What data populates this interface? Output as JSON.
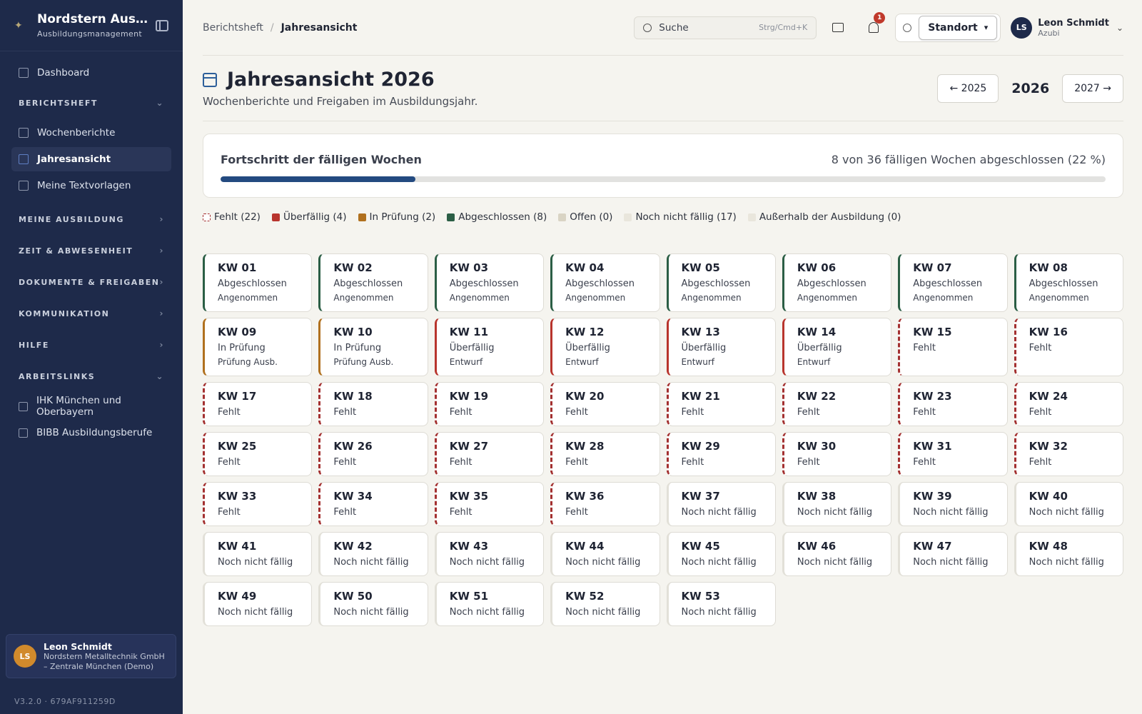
{
  "sidebar": {
    "brand_title": "Nordstern Ausbil…",
    "brand_sub": "Ausbildungsmanagement",
    "dashboard": "Dashboard",
    "sec_berichtsheft": "BERICHTSHEFT",
    "wochenberichte": "Wochenberichte",
    "jahresansicht": "Jahresansicht",
    "textvorlagen": "Meine Textvorlagen",
    "sec_ausbildung": "MEINE AUSBILDUNG",
    "sec_zeit": "ZEIT & ABWESENHEIT",
    "sec_dokumente": "DOKUMENTE & FREIGABEN",
    "sec_kommunikation": "KOMMUNIKATION",
    "sec_hilfe": "HILFE",
    "sec_arbeitslinks": "ARBEITSLINKS",
    "link_ihk": "IHK München und Oberbayern",
    "link_bibb": "BIBB Ausbildungsberufe",
    "user_initials": "LS",
    "user_name": "Leon Schmidt",
    "user_org": "Nordstern Metalltechnik GmbH – Zentrale München (Demo)",
    "version": "V3.2.0 · 679AF911259D"
  },
  "topbar": {
    "breadcrumb_parent": "Berichtsheft",
    "breadcrumb_sep": "/",
    "breadcrumb_current": "Jahresansicht",
    "search_placeholder": "Suche",
    "search_shortcut": "Strg/Cmd+K",
    "notification_count": "1",
    "location_label": "Standort",
    "user_initials": "LS",
    "user_name": "Leon Schmidt",
    "user_role": "Azubi"
  },
  "page": {
    "title": "Jahresansicht 2026",
    "subtitle": "Wochenberichte und Freigaben im Ausbildungsjahr.",
    "prev_year": "← 2025",
    "current_year": "2026",
    "next_year": "2027 →"
  },
  "progress": {
    "title": "Fortschritt der fälligen Wochen",
    "summary": "8 von 36 fälligen Wochen abgeschlossen (22 %)",
    "fraction": 0.22
  },
  "legend": [
    {
      "label": "Fehlt (22)",
      "color": "#a33030",
      "style": "dashed"
    },
    {
      "label": "Überfällig (4)",
      "color": "#b8342d",
      "style": "solid"
    },
    {
      "label": "In Prüfung (2)",
      "color": "#b0701e",
      "style": "solid"
    },
    {
      "label": "Abgeschlossen (8)",
      "color": "#2b5e45",
      "style": "solid"
    },
    {
      "label": "Offen (0)",
      "color": "#d9d4c4",
      "style": "solid"
    },
    {
      "label": "Noch nicht fällig (17)",
      "color": "#e9e6dc",
      "style": "solid"
    },
    {
      "label": "Außerhalb der Ausbildung (0)",
      "color": "#e9e6dc",
      "style": "solid"
    }
  ],
  "colors": {
    "abgeschlossen": "#2b5e45",
    "pruefung": "#b0701e",
    "ueberfaellig": "#b8342d",
    "fehlt": "#a33030",
    "nicht_faellig": "#e2e0d8"
  },
  "weeks": [
    {
      "kw": "KW 01",
      "status": "Abgeschlossen",
      "sub": "Angenommen",
      "type": "abgeschlossen"
    },
    {
      "kw": "KW 02",
      "status": "Abgeschlossen",
      "sub": "Angenommen",
      "type": "abgeschlossen"
    },
    {
      "kw": "KW 03",
      "status": "Abgeschlossen",
      "sub": "Angenommen",
      "type": "abgeschlossen"
    },
    {
      "kw": "KW 04",
      "status": "Abgeschlossen",
      "sub": "Angenommen",
      "type": "abgeschlossen"
    },
    {
      "kw": "KW 05",
      "status": "Abgeschlossen",
      "sub": "Angenommen",
      "type": "abgeschlossen"
    },
    {
      "kw": "KW 06",
      "status": "Abgeschlossen",
      "sub": "Angenommen",
      "type": "abgeschlossen"
    },
    {
      "kw": "KW 07",
      "status": "Abgeschlossen",
      "sub": "Angenommen",
      "type": "abgeschlossen"
    },
    {
      "kw": "KW 08",
      "status": "Abgeschlossen",
      "sub": "Angenommen",
      "type": "abgeschlossen"
    },
    {
      "kw": "KW 09",
      "status": "In Prüfung",
      "sub": "Prüfung Ausb.",
      "type": "pruefung"
    },
    {
      "kw": "KW 10",
      "status": "In Prüfung",
      "sub": "Prüfung Ausb.",
      "type": "pruefung"
    },
    {
      "kw": "KW 11",
      "status": "Überfällig",
      "sub": "Entwurf",
      "type": "ueberfaellig"
    },
    {
      "kw": "KW 12",
      "status": "Überfällig",
      "sub": "Entwurf",
      "type": "ueberfaellig"
    },
    {
      "kw": "KW 13",
      "status": "Überfällig",
      "sub": "Entwurf",
      "type": "ueberfaellig"
    },
    {
      "kw": "KW 14",
      "status": "Überfällig",
      "sub": "Entwurf",
      "type": "ueberfaellig"
    },
    {
      "kw": "KW 15",
      "status": "Fehlt",
      "sub": "",
      "type": "fehlt"
    },
    {
      "kw": "KW 16",
      "status": "Fehlt",
      "sub": "",
      "type": "fehlt"
    },
    {
      "kw": "KW 17",
      "status": "Fehlt",
      "sub": "",
      "type": "fehlt"
    },
    {
      "kw": "KW 18",
      "status": "Fehlt",
      "sub": "",
      "type": "fehlt"
    },
    {
      "kw": "KW 19",
      "status": "Fehlt",
      "sub": "",
      "type": "fehlt"
    },
    {
      "kw": "KW 20",
      "status": "Fehlt",
      "sub": "",
      "type": "fehlt"
    },
    {
      "kw": "KW 21",
      "status": "Fehlt",
      "sub": "",
      "type": "fehlt"
    },
    {
      "kw": "KW 22",
      "status": "Fehlt",
      "sub": "",
      "type": "fehlt"
    },
    {
      "kw": "KW 23",
      "status": "Fehlt",
      "sub": "",
      "type": "fehlt"
    },
    {
      "kw": "KW 24",
      "status": "Fehlt",
      "sub": "",
      "type": "fehlt"
    },
    {
      "kw": "KW 25",
      "status": "Fehlt",
      "sub": "",
      "type": "fehlt"
    },
    {
      "kw": "KW 26",
      "status": "Fehlt",
      "sub": "",
      "type": "fehlt"
    },
    {
      "kw": "KW 27",
      "status": "Fehlt",
      "sub": "",
      "type": "fehlt"
    },
    {
      "kw": "KW 28",
      "status": "Fehlt",
      "sub": "",
      "type": "fehlt"
    },
    {
      "kw": "KW 29",
      "status": "Fehlt",
      "sub": "",
      "type": "fehlt"
    },
    {
      "kw": "KW 30",
      "status": "Fehlt",
      "sub": "",
      "type": "fehlt"
    },
    {
      "kw": "KW 31",
      "status": "Fehlt",
      "sub": "",
      "type": "fehlt"
    },
    {
      "kw": "KW 32",
      "status": "Fehlt",
      "sub": "",
      "type": "fehlt"
    },
    {
      "kw": "KW 33",
      "status": "Fehlt",
      "sub": "",
      "type": "fehlt"
    },
    {
      "kw": "KW 34",
      "status": "Fehlt",
      "sub": "",
      "type": "fehlt"
    },
    {
      "kw": "KW 35",
      "status": "Fehlt",
      "sub": "",
      "type": "fehlt"
    },
    {
      "kw": "KW 36",
      "status": "Fehlt",
      "sub": "",
      "type": "fehlt"
    },
    {
      "kw": "KW 37",
      "status": "Noch nicht fällig",
      "sub": "",
      "type": "nicht_faellig"
    },
    {
      "kw": "KW 38",
      "status": "Noch nicht fällig",
      "sub": "",
      "type": "nicht_faellig"
    },
    {
      "kw": "KW 39",
      "status": "Noch nicht fällig",
      "sub": "",
      "type": "nicht_faellig"
    },
    {
      "kw": "KW 40",
      "status": "Noch nicht fällig",
      "sub": "",
      "type": "nicht_faellig"
    },
    {
      "kw": "KW 41",
      "status": "Noch nicht fällig",
      "sub": "",
      "type": "nicht_faellig"
    },
    {
      "kw": "KW 42",
      "status": "Noch nicht fällig",
      "sub": "",
      "type": "nicht_faellig"
    },
    {
      "kw": "KW 43",
      "status": "Noch nicht fällig",
      "sub": "",
      "type": "nicht_faellig"
    },
    {
      "kw": "KW 44",
      "status": "Noch nicht fällig",
      "sub": "",
      "type": "nicht_faellig"
    },
    {
      "kw": "KW 45",
      "status": "Noch nicht fällig",
      "sub": "",
      "type": "nicht_faellig"
    },
    {
      "kw": "KW 46",
      "status": "Noch nicht fällig",
      "sub": "",
      "type": "nicht_faellig"
    },
    {
      "kw": "KW 47",
      "status": "Noch nicht fällig",
      "sub": "",
      "type": "nicht_faellig"
    },
    {
      "kw": "KW 48",
      "status": "Noch nicht fällig",
      "sub": "",
      "type": "nicht_faellig"
    },
    {
      "kw": "KW 49",
      "status": "Noch nicht fällig",
      "sub": "",
      "type": "nicht_faellig"
    },
    {
      "kw": "KW 50",
      "status": "Noch nicht fällig",
      "sub": "",
      "type": "nicht_faellig"
    },
    {
      "kw": "KW 51",
      "status": "Noch nicht fällig",
      "sub": "",
      "type": "nicht_faellig"
    },
    {
      "kw": "KW 52",
      "status": "Noch nicht fällig",
      "sub": "",
      "type": "nicht_faellig"
    },
    {
      "kw": "KW 53",
      "status": "Noch nicht fällig",
      "sub": "",
      "type": "nicht_faellig"
    }
  ]
}
